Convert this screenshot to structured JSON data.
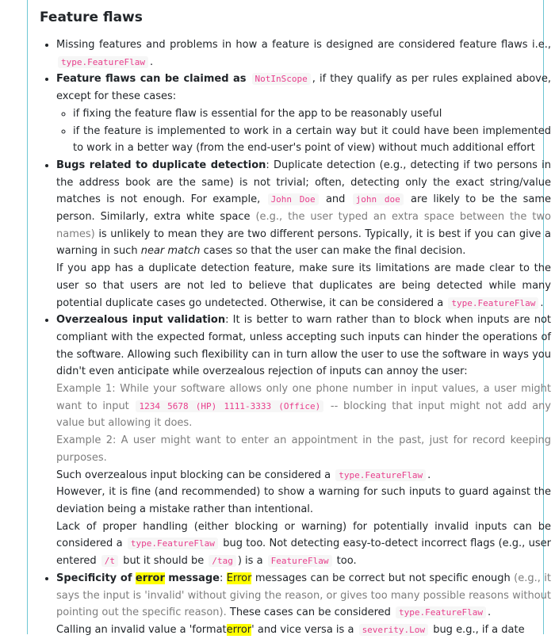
{
  "heading": "Feature flaws",
  "b1": {
    "text": "Missing features and problems in how a feature is designed are considered feature flaws i.e.,",
    "code": "type.FeatureFlaw",
    "end": "."
  },
  "b2": {
    "bold": "Feature flaws can be claimed as",
    "code": "NotInScope",
    "text": ", if they qualify as per rules explained above, except for these cases:",
    "subs": [
      "if fixing the feature flaw is essential for the app to be reasonably useful",
      "if the feature is implemented to work in a certain way but it could have been implemented to work in a better way (from the end-user's point of view) without much additional effort"
    ]
  },
  "b3": {
    "bold": "Bugs related to duplicate detection",
    "t1": ": Duplicate detection (e.g., detecting if two persons in the address book are the same) is not trivial; often, detecting only the exact string/value matches is not enough. For example,",
    "c1": "John Doe",
    "t2": "and",
    "c2": "john doe",
    "t3": "are likely to be the same person. Similarly, extra white space",
    "grey": "(e.g., the user typed an extra space between the two names)",
    "t4": "is unlikely to mean they are two different persons. Typically, it is best if you can give a warning in such",
    "em": "near match",
    "t5": "cases so that the user can make the final decision.",
    "p2": "If you app has a duplicate detection feature, make sure its limitations are made clear to the user so that users are not led to believe that duplicates are being detected while many potential duplicate cases go undetected. Otherwise, it can be considered a",
    "c3": "type.FeatureFlaw",
    "end": "."
  },
  "b4": {
    "bold": "Overzealous input validation",
    "t1": ": It is better to warn rather than to block when inputs are not compliant with the expected format, unless accepting such inputs can hinder the operations of the software. Allowing such flexibility can in turn allow the user to use the software in ways you didn't even anticipate while overzealous rejection of inputs can annoy the user:",
    "ex1a": "Example 1: While your software allows only one phone number in input values, a user might want to input",
    "ex1c": "1234 5678 (HP) 1111-3333 (Office)",
    "ex1b": "-- blocking that input might not add any value but allowing it does.",
    "ex2": "Example 2: A user might want to enter an appointment in the past, just for record keeping purposes.",
    "s1": "Such overzealous input blocking can be considered a",
    "s1c": "type.FeatureFlaw",
    "s1e": ".",
    "s2": "However, it is fine (and recommended) to show a warning for such inputs to guard against the deviation being a mistake rather than intentional.",
    "s3a": "Lack of proper handling (either blocking or warning) for potentially invalid inputs can be considered a",
    "s3c": "type.FeatureFlaw",
    "s3b": "bug too. Not detecting easy-to-detect incorrect flags (e.g., user entered",
    "s3c2": "/t",
    "s3d": "but it should be",
    "s3c3": "/tag",
    "s3e": ") is a",
    "s3c4": "FeatureFlaw",
    "s3f": "too."
  },
  "b5": {
    "bold1": "Specificity of",
    "mark1": "error",
    "bold2": "message",
    "t0": ":",
    "mark2": "Error",
    "t1": "messages can be correct but not specific enough",
    "grey": "(e.g., it says the input is 'invalid' without giving the reason, or gives too many possible reasons without pointing out the specific reason).",
    "t2": "These cases can be considered",
    "c1": "type.FeatureFlaw",
    "end": ".",
    "cut": "Calling an invalid value a 'format",
    "cutmark": "error",
    "cut2": "' and vice versa is a",
    "cutcode": "severity.Low",
    "cut3": "bug e.g., if a date"
  }
}
